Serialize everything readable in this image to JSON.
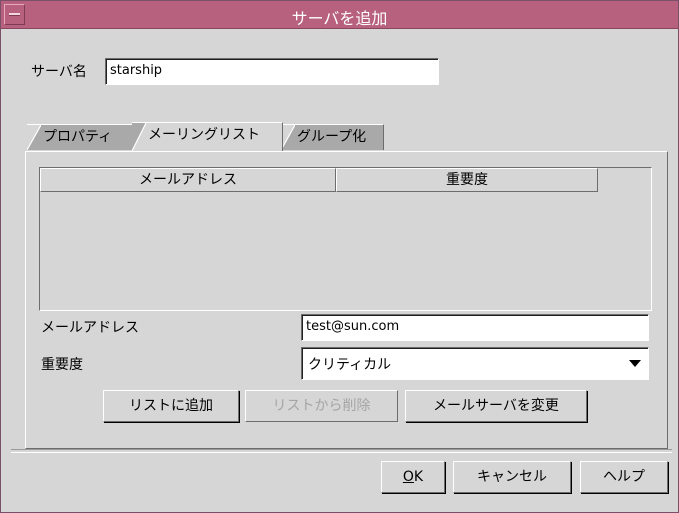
{
  "window": {
    "title": "サーバを追加"
  },
  "server": {
    "label": "サーバ名",
    "value": "starship"
  },
  "tabs": [
    {
      "label": "プロパティ"
    },
    {
      "label": "メーリングリスト"
    },
    {
      "label": "グループ化"
    }
  ],
  "mailing_list": {
    "columns": [
      "メールアドレス",
      "重要度"
    ],
    "rows": []
  },
  "form": {
    "email_label": "メールアドレス",
    "email_value": "test@sun.com",
    "severity_label": "重要度",
    "severity_value": "クリティカル"
  },
  "buttons": {
    "add_to_list": "リストに追加",
    "remove_from_list": "リストから削除",
    "change_mail_server": "メールサーバを変更",
    "ok_mnemonic": "O",
    "ok_rest": "K",
    "cancel": "キャンセル",
    "help": "ヘルプ"
  }
}
